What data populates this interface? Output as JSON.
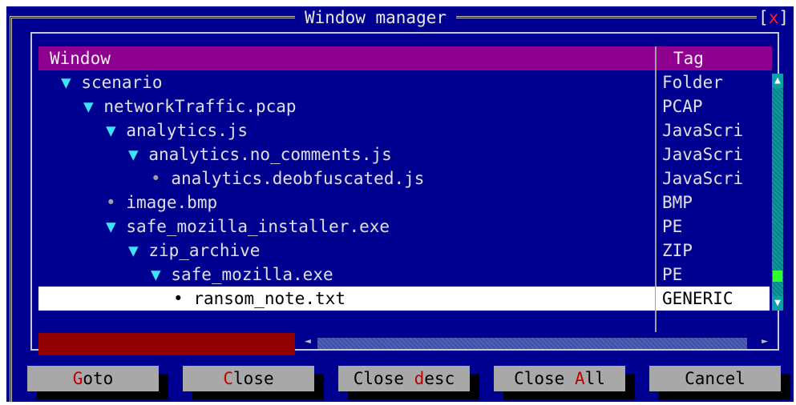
{
  "window": {
    "title": "Window manager",
    "close_label": "x"
  },
  "columns": {
    "window": "Window",
    "tag": "Tag"
  },
  "rows": [
    {
      "marker": "▼",
      "name": "scenario",
      "tag": "Folder"
    },
    {
      "marker": "▼",
      "name": "networkTraffic.pcap",
      "tag": "PCAP"
    },
    {
      "marker": "▼",
      "name": "analytics.js",
      "tag": "JavaScri"
    },
    {
      "marker": "▼",
      "name": "analytics.no_comments.js",
      "tag": "JavaScri"
    },
    {
      "marker": "•",
      "name": "analytics.deobfuscated.js",
      "tag": "JavaScri"
    },
    {
      "marker": "•",
      "name": "image.bmp",
      "tag": "BMP"
    },
    {
      "marker": "▼",
      "name": "safe_mozilla_installer.exe",
      "tag": "PE"
    },
    {
      "marker": "▼",
      "name": "zip_archive",
      "tag": "ZIP"
    },
    {
      "marker": "▼",
      "name": "safe_mozilla.exe",
      "tag": "PE"
    },
    {
      "marker": "•",
      "name": "ransom_note.txt",
      "tag": "GENERIC"
    }
  ],
  "buttons": {
    "goto": {
      "hot": "G",
      "rest": "oto"
    },
    "close": {
      "hot": "C",
      "rest": "lose"
    },
    "close_desc": {
      "pre": "Close ",
      "hot": "d",
      "rest": "esc"
    },
    "close_all": {
      "pre": "Close ",
      "hot": "A",
      "rest": "ll"
    },
    "cancel": {
      "label": "Cancel"
    }
  },
  "colors": {
    "background": "#000090",
    "header": "#900090",
    "selection": "#ffffff",
    "hotkey": "#c00000",
    "button": "#a8a8a8"
  }
}
